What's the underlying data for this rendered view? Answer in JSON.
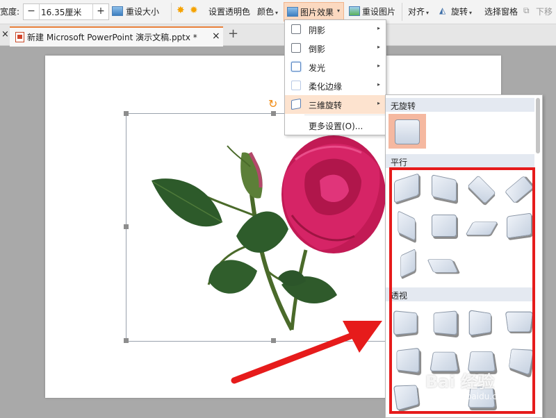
{
  "toolbar": {
    "width_label": "宽度:",
    "width_value": "16.35厘米",
    "minus": "−",
    "plus": "+",
    "reset_size": "重设大小",
    "set_transparent": "设置透明色",
    "color": "颜色",
    "picture_effects": "图片效果",
    "reset_picture": "重设图片",
    "align": "对齐",
    "rotate": "旋转",
    "selection_pane": "选择窗格",
    "move_down": "下移"
  },
  "tabs": {
    "close_left": "×",
    "doc_title": "新建 Microsoft PowerPoint 演示文稿.pptx *",
    "close": "×",
    "new_tab": "+"
  },
  "effects_menu": {
    "items": [
      {
        "label": "阴影",
        "has_submenu": true
      },
      {
        "label": "倒影",
        "has_submenu": true
      },
      {
        "label": "发光",
        "has_submenu": true
      },
      {
        "label": "柔化边缘",
        "has_submenu": true
      },
      {
        "label": "三维旋转",
        "has_submenu": true,
        "active": true
      },
      {
        "label": "更多设置(O)...",
        "has_submenu": false
      }
    ],
    "arrow": "▸"
  },
  "rotation_panel": {
    "sections": [
      {
        "title": "无旋转",
        "count": 1
      },
      {
        "title": "平行",
        "count": 10
      },
      {
        "title": "透视",
        "count": 10
      }
    ]
  },
  "watermark": {
    "main": "Bai 经验",
    "sub": "jingyan.baidu.com"
  },
  "colors": {
    "accent": "#e9803a",
    "highlight": "#fde3cf",
    "annotation": "#e61b1b"
  }
}
